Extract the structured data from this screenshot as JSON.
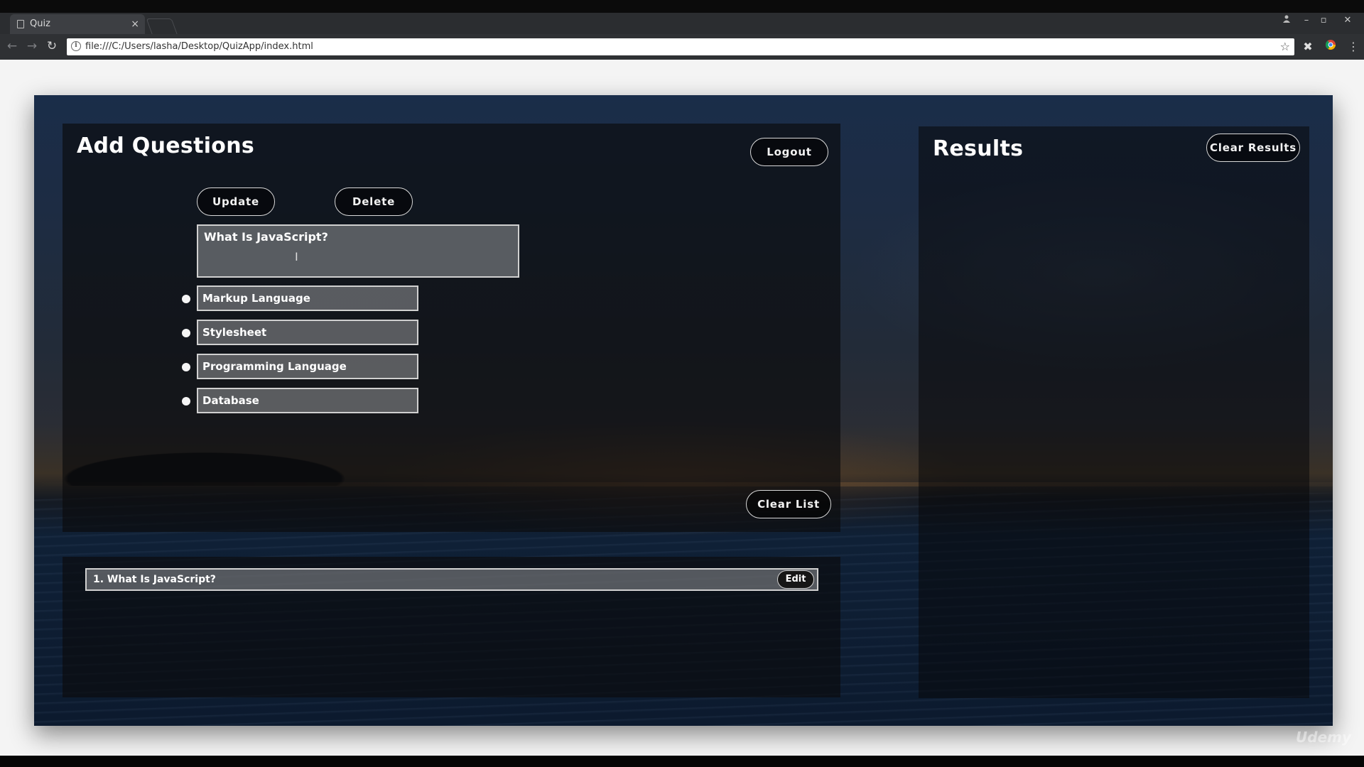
{
  "browser": {
    "tab_title": "Quiz",
    "tab_close": "×",
    "url": "file:///C:/Users/lasha/Desktop/QuizApp/index.html",
    "window_controls": [
      "–",
      "▫",
      "✕"
    ]
  },
  "add_questions": {
    "title": "Add Questions",
    "logout_label": "Logout",
    "update_label": "Update",
    "delete_label": "Delete",
    "question_text": "What Is JavaScript?",
    "choices": [
      "Markup Language",
      "Stylesheet",
      "Programming Language",
      "Database"
    ],
    "clear_list_label": "Clear List"
  },
  "question_list": {
    "items": [
      {
        "text": "1. What Is JavaScript?",
        "edit_label": "Edit"
      }
    ]
  },
  "results": {
    "title": "Results",
    "clear_results_label": "Clear Results"
  },
  "watermark": "Udemy"
}
